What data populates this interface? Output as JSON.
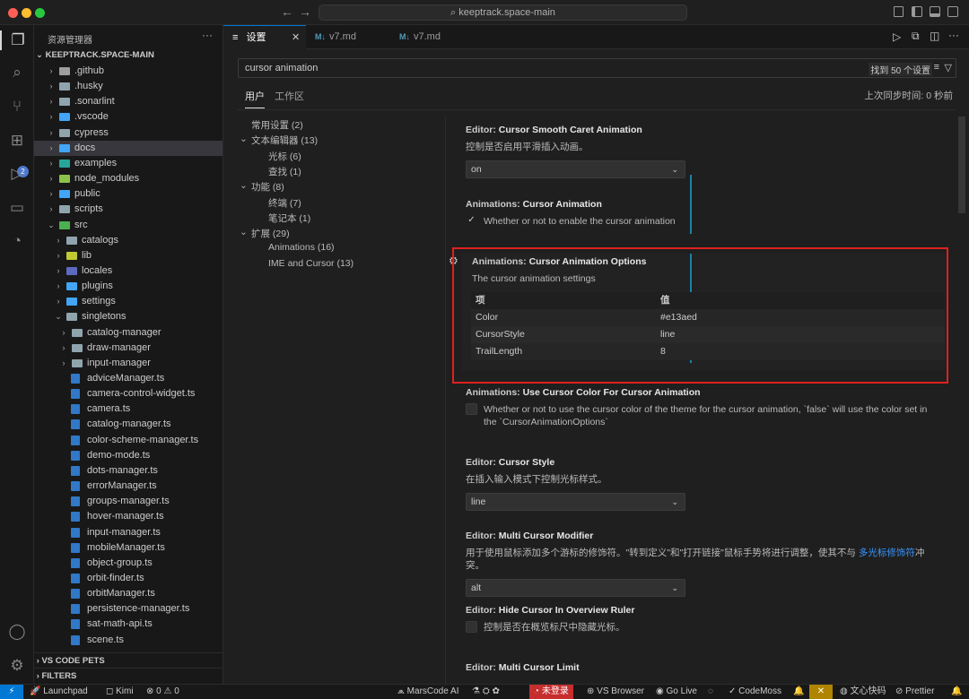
{
  "window": {
    "title": "keeptrack.space-main",
    "traffic_lights": [
      "#ff5f57",
      "#febc2e",
      "#28c840"
    ]
  },
  "activity_bar": {
    "icons": [
      "files-icon",
      "search-icon",
      "source-control-icon",
      "extensions-icon",
      "run-debug-icon",
      "remote-explorer-icon",
      "git-graph-icon",
      "account-icon",
      "settings-gear-icon"
    ],
    "extensions_badge": "2"
  },
  "sidebar": {
    "title": "资源管理器",
    "more": "···",
    "root": "KEEPTRACK.SPACE-MAIN",
    "items": [
      {
        "label": ".github",
        "depth": 1,
        "expanded": false
      },
      {
        "label": ".husky",
        "depth": 1,
        "expanded": false
      },
      {
        "label": ".sonarlint",
        "depth": 1,
        "expanded": false
      },
      {
        "label": ".vscode",
        "depth": 1,
        "expanded": false
      },
      {
        "label": "cypress",
        "depth": 1,
        "expanded": false
      },
      {
        "label": "docs",
        "depth": 1,
        "expanded": false,
        "selected": true
      },
      {
        "label": "examples",
        "depth": 1,
        "expanded": false
      },
      {
        "label": "node_modules",
        "depth": 1,
        "expanded": false
      },
      {
        "label": "public",
        "depth": 1,
        "expanded": false
      },
      {
        "label": "scripts",
        "depth": 1,
        "expanded": false
      },
      {
        "label": "src",
        "depth": 1,
        "expanded": true
      },
      {
        "label": "catalogs",
        "depth": 2,
        "expanded": false
      },
      {
        "label": "lib",
        "depth": 2,
        "expanded": false
      },
      {
        "label": "locales",
        "depth": 2,
        "expanded": false
      },
      {
        "label": "plugins",
        "depth": 2,
        "expanded": false
      },
      {
        "label": "settings",
        "depth": 2,
        "expanded": false
      },
      {
        "label": "singletons",
        "depth": 2,
        "expanded": true
      },
      {
        "label": "catalog-manager",
        "depth": 3,
        "expanded": false
      },
      {
        "label": "draw-manager",
        "depth": 3,
        "expanded": false
      },
      {
        "label": "input-manager",
        "depth": 3,
        "expanded": false
      },
      {
        "label": "adviceManager.ts",
        "depth": 3,
        "file": true
      },
      {
        "label": "camera-control-widget.ts",
        "depth": 3,
        "file": true
      },
      {
        "label": "camera.ts",
        "depth": 3,
        "file": true
      },
      {
        "label": "catalog-manager.ts",
        "depth": 3,
        "file": true
      },
      {
        "label": "color-scheme-manager.ts",
        "depth": 3,
        "file": true
      },
      {
        "label": "demo-mode.ts",
        "depth": 3,
        "file": true
      },
      {
        "label": "dots-manager.ts",
        "depth": 3,
        "file": true
      },
      {
        "label": "errorManager.ts",
        "depth": 3,
        "file": true
      },
      {
        "label": "groups-manager.ts",
        "depth": 3,
        "file": true
      },
      {
        "label": "hover-manager.ts",
        "depth": 3,
        "file": true
      },
      {
        "label": "input-manager.ts",
        "depth": 3,
        "file": true
      },
      {
        "label": "mobileManager.ts",
        "depth": 3,
        "file": true
      },
      {
        "label": "object-group.ts",
        "depth": 3,
        "file": true
      },
      {
        "label": "orbit-finder.ts",
        "depth": 3,
        "file": true
      },
      {
        "label": "orbitManager.ts",
        "depth": 3,
        "file": true
      },
      {
        "label": "persistence-manager.ts",
        "depth": 3,
        "file": true
      },
      {
        "label": "sat-math-api.ts",
        "depth": 3,
        "file": true
      },
      {
        "label": "scene.ts",
        "depth": 3,
        "file": true
      }
    ],
    "sections": [
      "VS CODE PETS",
      "FILTERS"
    ]
  },
  "tabs": [
    {
      "label": "设置",
      "icon": "≡",
      "active": true,
      "close": "✕"
    },
    {
      "label": "v7.md",
      "icon": "M↓",
      "active": false
    },
    {
      "label": "v7.md",
      "icon": "M↓",
      "active": false
    }
  ],
  "settings": {
    "search_value": "cursor animation",
    "found": "找到 50 个设置",
    "scope_tabs": [
      "用户",
      "工作区"
    ],
    "sync": "上次同步时间: 0 秒前",
    "toc": [
      {
        "label": "常用设置 (2)",
        "indent": 0,
        "chev": ""
      },
      {
        "label": "文本编辑器 (13)",
        "indent": 0,
        "chev": "⌄"
      },
      {
        "label": "光标 (6)",
        "indent": 1,
        "chev": ""
      },
      {
        "label": "查找 (1)",
        "indent": 1,
        "chev": ""
      },
      {
        "label": "功能 (8)",
        "indent": 0,
        "chev": "⌄"
      },
      {
        "label": "终端 (7)",
        "indent": 1,
        "chev": ""
      },
      {
        "label": "笔记本 (1)",
        "indent": 1,
        "chev": ""
      },
      {
        "label": "扩展 (29)",
        "indent": 0,
        "chev": "⌄"
      },
      {
        "label": "Animations (16)",
        "indent": 1,
        "chev": ""
      },
      {
        "label": "IME and Cursor (13)",
        "indent": 1,
        "chev": ""
      }
    ],
    "items": {
      "smooth_caret": {
        "cat": "Editor: ",
        "title": "Cursor Smooth Caret Animation",
        "desc": "控制是否启用平滑插入动画。",
        "value": "on"
      },
      "cursor_animation": {
        "cat": "Animations: ",
        "title": "Cursor Animation",
        "desc": "Whether or not to enable the cursor animation",
        "checked": "✓"
      },
      "cursor_animation_options": {
        "cat": "Animations: ",
        "title": "Cursor Animation Options",
        "desc": "The cursor animation settings",
        "header": {
          "k": "项",
          "v": "值"
        },
        "rows": [
          {
            "k": "Color",
            "v": "#e13aed"
          },
          {
            "k": "CursorStyle",
            "v": "line"
          },
          {
            "k": "TrailLength",
            "v": "8"
          }
        ]
      },
      "use_cursor_color": {
        "cat": "Animations: ",
        "title": "Use Cursor Color For Cursor Animation",
        "desc": "Whether or not to use the cursor color of the theme for the cursor animation, `false` will use the color set in the `CursorAnimationOptions`"
      },
      "cursor_style": {
        "cat": "Editor: ",
        "title": "Cursor Style",
        "desc": "在插入输入模式下控制光标样式。",
        "value": "line"
      },
      "multi_cursor_modifier": {
        "cat": "Editor: ",
        "title": "Multi Cursor Modifier",
        "desc_pre": "用于使用鼠标添加多个游标的修饰符。\"转到定义\"和\"打开链接\"鼠标手势将进行调整，使其不与 ",
        "desc_link": "多光标修饰符",
        "desc_post": "冲突。",
        "value": "alt"
      },
      "hide_cursor": {
        "cat": "Editor: ",
        "title": "Hide Cursor In Overview Ruler",
        "desc": "控制是否在概览标尺中隐藏光标。"
      },
      "multi_cursor_limit": {
        "cat": "Editor: ",
        "title": "Multi Cursor Limit"
      }
    }
  },
  "statusbar": {
    "launchpad": "Launchpad",
    "kimi": "Kimi",
    "problems": "⊗ 0 ⚠ 0",
    "marscode": "MarsCode AI",
    "login": "未登录",
    "vsbrowser": "VS Browser",
    "golive": "Go Live",
    "codemoss": "CodeMoss",
    "wenxin": "文心快码",
    "prettier": "Prettier"
  },
  "colors": {
    "accent": "#0078d4",
    "highlight_border": "#e02020",
    "modified_bar": "#1b81a8",
    "folder": "#90a4ae"
  }
}
